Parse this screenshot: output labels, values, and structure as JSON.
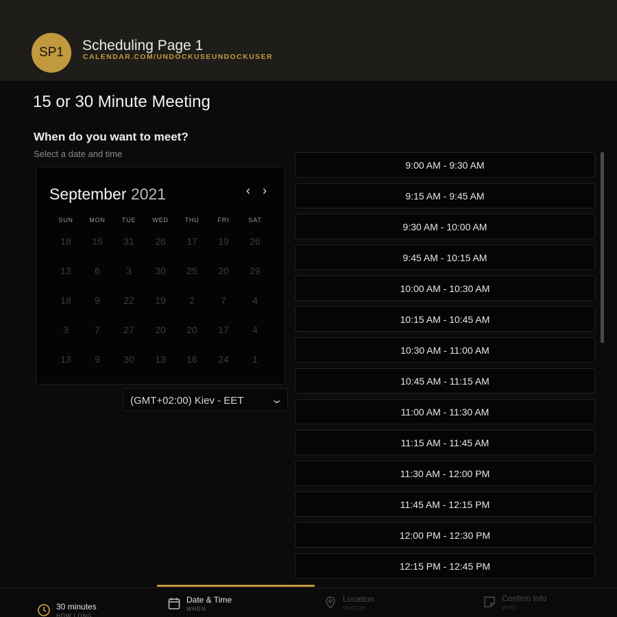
{
  "header": {
    "avatar_initials": "SP1",
    "page_name": "Scheduling Page 1",
    "page_url": "CALENDAR.COM/UNDOCKUSEUNDOCKUSER"
  },
  "meeting": {
    "title": "15 or 30 Minute Meeting",
    "question": "When do you want to meet?",
    "subtitle": "Select a date and time"
  },
  "calendar": {
    "month": "September",
    "year": "2021",
    "weekdays": [
      "SUN",
      "MON",
      "TUE",
      "WED",
      "THU",
      "FRI",
      "SAT"
    ],
    "days": [
      "18",
      "15",
      "31",
      "26",
      "17",
      "19",
      "26",
      "13",
      "6",
      "3",
      "30",
      "25",
      "20",
      "29",
      "18",
      "9",
      "22",
      "19",
      "2",
      "7",
      "4",
      "3",
      "7",
      "27",
      "20",
      "20",
      "17",
      "4",
      "13",
      "9",
      "30",
      "13",
      "16",
      "24",
      "1"
    ]
  },
  "timezone": {
    "selected": "(GMT+02:00) Kiev - EET"
  },
  "slots": [
    "9:00 AM - 9:30 AM",
    "9:15 AM - 9:45 AM",
    "9:30 AM - 10:00 AM",
    "9:45 AM - 10:15 AM",
    "10:00 AM - 10:30 AM",
    "10:15 AM - 10:45 AM",
    "10:30 AM - 11:00 AM",
    "10:45 AM - 11:15 AM",
    "11:00 AM - 11:30 AM",
    "11:15 AM - 11:45 AM",
    "11:30 AM - 12:00 PM",
    "11:45 AM - 12:15 PM",
    "12:00 PM - 12:30 PM",
    "12:15 PM - 12:45 PM"
  ],
  "footer": {
    "steps": [
      {
        "label": "30 minutes",
        "sub": "HOW LONG",
        "icon": "clock-icon",
        "state": "done"
      },
      {
        "label": "Date & Time",
        "sub": "WHEN",
        "icon": "calendar-icon",
        "state": "active"
      },
      {
        "label": "Location",
        "sub": "WHERE",
        "icon": "location-pin-icon",
        "state": "upcoming"
      },
      {
        "label": "Confirm Info",
        "sub": "WHO",
        "icon": "note-icon",
        "state": "upcoming"
      }
    ]
  },
  "colors": {
    "accent": "#c19a3e",
    "background": "#0b0b0b",
    "header": "#1f1d1a"
  }
}
